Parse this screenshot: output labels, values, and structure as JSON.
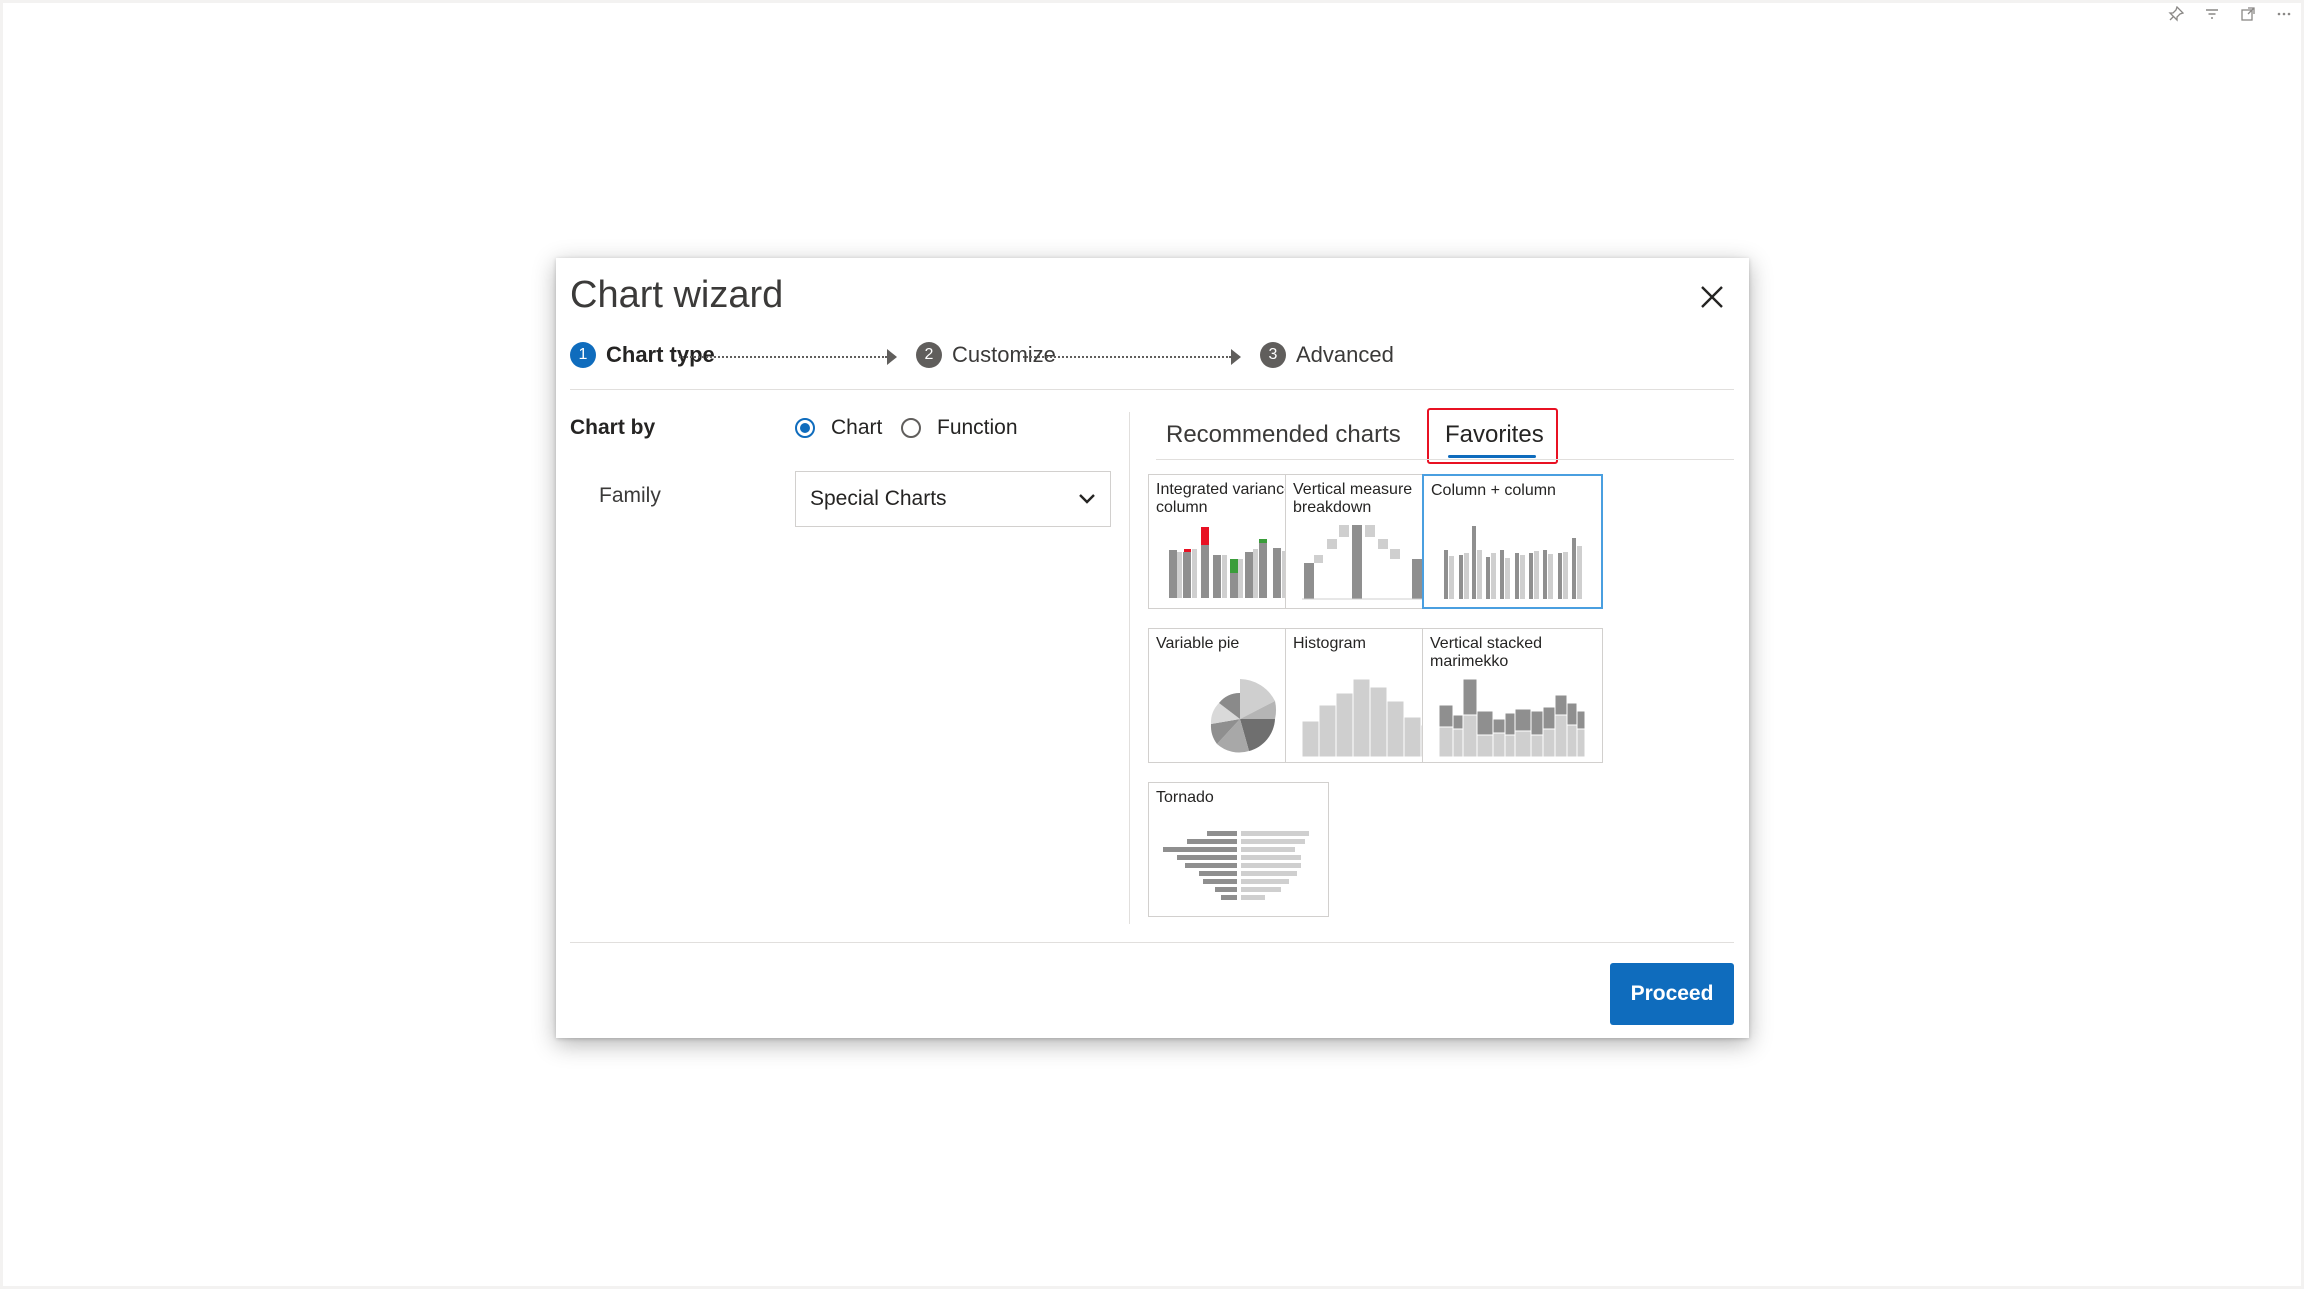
{
  "dialog": {
    "title": "Chart wizard",
    "steps": [
      {
        "number": "1",
        "label": "Chart type",
        "active": true
      },
      {
        "number": "2",
        "label": "Customize",
        "active": false
      },
      {
        "number": "3",
        "label": "Advanced",
        "active": false
      }
    ],
    "chart_by": {
      "label": "Chart by",
      "options": [
        "Chart",
        "Function"
      ],
      "selected": "Chart"
    },
    "family": {
      "label": "Family",
      "value": "Special Charts"
    },
    "tabs": {
      "recommended": "Recommended charts",
      "favorites": "Favorites",
      "active": "Favorites"
    },
    "charts": [
      {
        "label": "Integrated variance column",
        "icon": "integrated-variance-column-thumbnail"
      },
      {
        "label": "Vertical measure breakdown",
        "icon": "vertical-measure-breakdown-thumbnail"
      },
      {
        "label": "Column + column",
        "icon": "column-plus-column-thumbnail",
        "selected": true
      },
      {
        "label": "Variable pie",
        "icon": "variable-pie-thumbnail"
      },
      {
        "label": "Histogram",
        "icon": "histogram-thumbnail"
      },
      {
        "label": "Vertical stacked marimekko",
        "icon": "vertical-stacked-marimekko-thumbnail"
      },
      {
        "label": "Tornado",
        "icon": "tornado-thumbnail"
      }
    ],
    "proceed_label": "Proceed"
  },
  "toolbar_icons": [
    "pin-icon",
    "filter-icon",
    "focus-mode-icon",
    "more-options-icon"
  ],
  "colors": {
    "accent": "#0f6cbd",
    "highlight_border": "#e81123",
    "variance_negative": "#e81123",
    "variance_positive": "#3a9d3a"
  }
}
